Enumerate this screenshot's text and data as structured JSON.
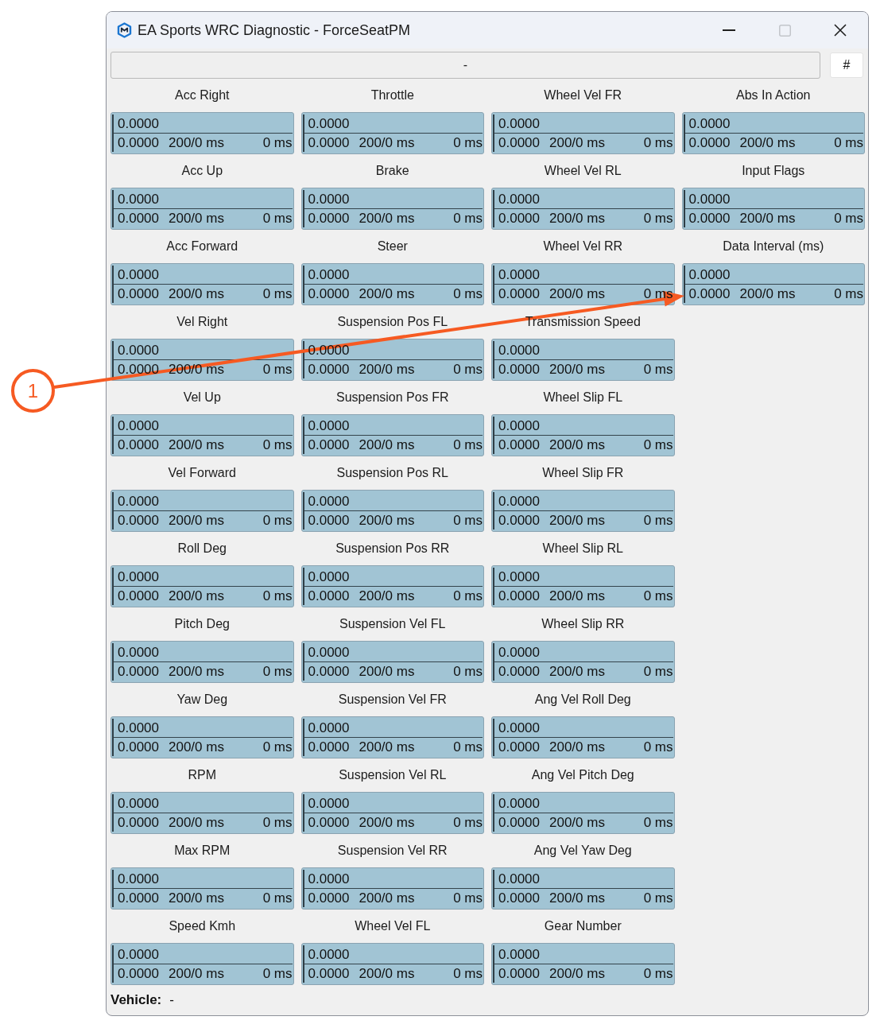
{
  "window": {
    "title": "EA Sports WRC Diagnostic - ForceSeatPM",
    "controls": [
      {
        "kind": "minimize",
        "disabled": false
      },
      {
        "kind": "maximize",
        "disabled": true
      },
      {
        "kind": "close",
        "disabled": false
      }
    ]
  },
  "toolbar": {
    "status": "-",
    "button": "#"
  },
  "gauge_rows": [
    [
      {
        "title": "Acc Right",
        "value": "0.0000",
        "details": [
          "0.0000",
          "200/0 ms",
          "0 ms"
        ]
      },
      {
        "title": "Throttle",
        "value": "0.0000",
        "details": [
          "0.0000",
          "200/0 ms",
          "0 ms"
        ]
      },
      {
        "title": "Wheel Vel FR",
        "value": "0.0000",
        "details": [
          "0.0000",
          "200/0 ms",
          "0 ms"
        ]
      },
      {
        "title": "Abs In Action",
        "value": "0.0000",
        "details": [
          "0.0000",
          "200/0 ms",
          "0 ms"
        ]
      }
    ],
    [
      {
        "title": "Acc Up",
        "value": "0.0000",
        "details": [
          "0.0000",
          "200/0 ms",
          "0 ms"
        ]
      },
      {
        "title": "Brake",
        "value": "0.0000",
        "details": [
          "0.0000",
          "200/0 ms",
          "0 ms"
        ]
      },
      {
        "title": "Wheel Vel RL",
        "value": "0.0000",
        "details": [
          "0.0000",
          "200/0 ms",
          "0 ms"
        ]
      },
      {
        "title": "Input Flags",
        "value": "0.0000",
        "details": [
          "0.0000",
          "200/0 ms",
          "0 ms"
        ]
      }
    ],
    [
      {
        "title": "Acc Forward",
        "value": "0.0000",
        "details": [
          "0.0000",
          "200/0 ms",
          "0 ms"
        ]
      },
      {
        "title": "Steer",
        "value": "0.0000",
        "details": [
          "0.0000",
          "200/0 ms",
          "0 ms"
        ]
      },
      {
        "title": "Wheel Vel RR",
        "value": "0.0000",
        "details": [
          "0.0000",
          "200/0 ms",
          "0 ms"
        ]
      },
      {
        "title": "Data Interval (ms)",
        "value": "0.0000",
        "details": [
          "0.0000",
          "200/0 ms",
          "0 ms"
        ]
      }
    ],
    [
      {
        "title": "Vel Right",
        "value": "0.0000",
        "details": [
          "0.0000",
          "200/0 ms",
          "0 ms"
        ]
      },
      {
        "title": "Suspension Pos FL",
        "value": "0.0000",
        "details": [
          "0.0000",
          "200/0 ms",
          "0 ms"
        ]
      },
      {
        "title": "Transmission Speed",
        "value": "0.0000",
        "details": [
          "0.0000",
          "200/0 ms",
          "0 ms"
        ]
      }
    ],
    [
      {
        "title": "Vel Up",
        "value": "0.0000",
        "details": [
          "0.0000",
          "200/0 ms",
          "0 ms"
        ]
      },
      {
        "title": "Suspension Pos FR",
        "value": "0.0000",
        "details": [
          "0.0000",
          "200/0 ms",
          "0 ms"
        ]
      },
      {
        "title": "Wheel Slip FL",
        "value": "0.0000",
        "details": [
          "0.0000",
          "200/0 ms",
          "0 ms"
        ]
      }
    ],
    [
      {
        "title": "Vel Forward",
        "value": "0.0000",
        "details": [
          "0.0000",
          "200/0 ms",
          "0 ms"
        ]
      },
      {
        "title": "Suspension Pos RL",
        "value": "0.0000",
        "details": [
          "0.0000",
          "200/0 ms",
          "0 ms"
        ]
      },
      {
        "title": "Wheel Slip FR",
        "value": "0.0000",
        "details": [
          "0.0000",
          "200/0 ms",
          "0 ms"
        ]
      }
    ],
    [
      {
        "title": "Roll Deg",
        "value": "0.0000",
        "details": [
          "0.0000",
          "200/0 ms",
          "0 ms"
        ]
      },
      {
        "title": "Suspension Pos RR",
        "value": "0.0000",
        "details": [
          "0.0000",
          "200/0 ms",
          "0 ms"
        ]
      },
      {
        "title": "Wheel Slip RL",
        "value": "0.0000",
        "details": [
          "0.0000",
          "200/0 ms",
          "0 ms"
        ]
      }
    ],
    [
      {
        "title": "Pitch Deg",
        "value": "0.0000",
        "details": [
          "0.0000",
          "200/0 ms",
          "0 ms"
        ]
      },
      {
        "title": "Suspension Vel FL",
        "value": "0.0000",
        "details": [
          "0.0000",
          "200/0 ms",
          "0 ms"
        ]
      },
      {
        "title": "Wheel Slip RR",
        "value": "0.0000",
        "details": [
          "0.0000",
          "200/0 ms",
          "0 ms"
        ]
      }
    ],
    [
      {
        "title": "Yaw Deg",
        "value": "0.0000",
        "details": [
          "0.0000",
          "200/0 ms",
          "0 ms"
        ]
      },
      {
        "title": "Suspension Vel FR",
        "value": "0.0000",
        "details": [
          "0.0000",
          "200/0 ms",
          "0 ms"
        ]
      },
      {
        "title": "Ang Vel Roll Deg",
        "value": "0.0000",
        "details": [
          "0.0000",
          "200/0 ms",
          "0 ms"
        ]
      }
    ],
    [
      {
        "title": "RPM",
        "value": "0.0000",
        "details": [
          "0.0000",
          "200/0 ms",
          "0 ms"
        ]
      },
      {
        "title": "Suspension Vel RL",
        "value": "0.0000",
        "details": [
          "0.0000",
          "200/0 ms",
          "0 ms"
        ]
      },
      {
        "title": "Ang Vel Pitch Deg",
        "value": "0.0000",
        "details": [
          "0.0000",
          "200/0 ms",
          "0 ms"
        ]
      }
    ],
    [
      {
        "title": "Max RPM",
        "value": "0.0000",
        "details": [
          "0.0000",
          "200/0 ms",
          "0 ms"
        ]
      },
      {
        "title": "Suspension Vel RR",
        "value": "0.0000",
        "details": [
          "0.0000",
          "200/0 ms",
          "0 ms"
        ]
      },
      {
        "title": "Ang Vel Yaw Deg",
        "value": "0.0000",
        "details": [
          "0.0000",
          "200/0 ms",
          "0 ms"
        ]
      }
    ],
    [
      {
        "title": "Speed Kmh",
        "value": "0.0000",
        "details": [
          "0.0000",
          "200/0 ms",
          "0 ms"
        ]
      },
      {
        "title": "Wheel Vel FL",
        "value": "0.0000",
        "details": [
          "0.0000",
          "200/0 ms",
          "0 ms"
        ]
      },
      {
        "title": "Gear Number",
        "value": "0.0000",
        "details": [
          "0.0000",
          "200/0 ms",
          "0 ms"
        ]
      }
    ]
  ],
  "footer": {
    "label": "Vehicle:",
    "value": "-"
  },
  "annotation": {
    "label": "1"
  }
}
